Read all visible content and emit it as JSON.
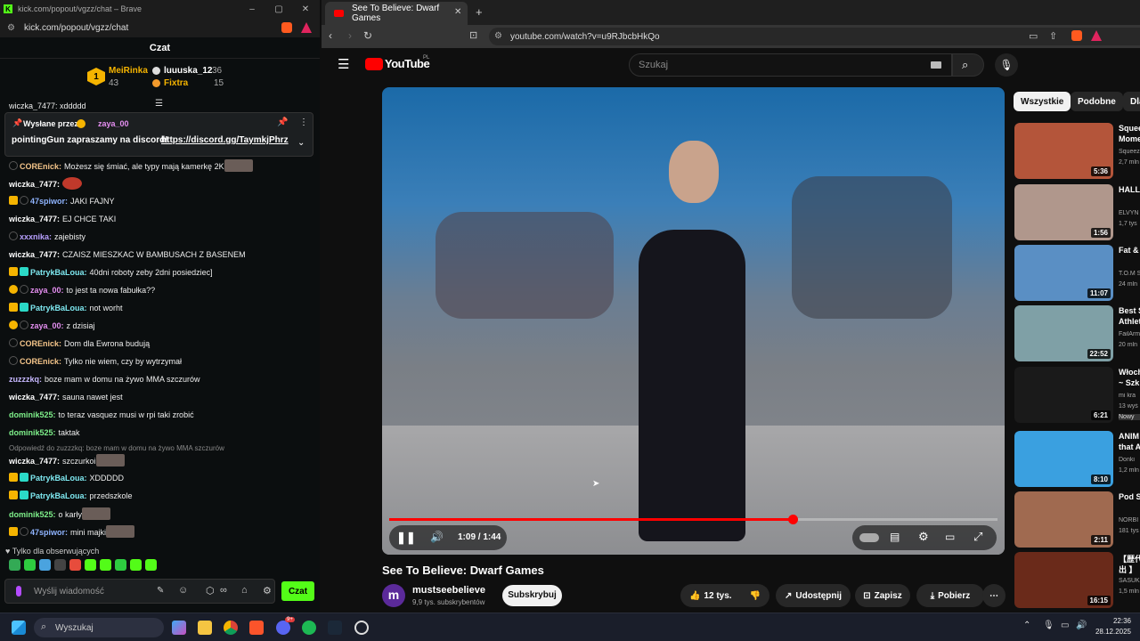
{
  "kick": {
    "window_title": "kick.com/popout/vgzz/chat – Brave",
    "url": "kick.com/popout/vgzz/chat",
    "header": "Czat",
    "leaderboard": [
      {
        "name": "MeiRinka",
        "count": "43",
        "color": "#f5b400"
      },
      {
        "name": "luuuska_12",
        "count": "36",
        "color": "#ffffff"
      },
      {
        "name": "Fixtra",
        "count": "15",
        "color": "#f5b400"
      }
    ],
    "cut_top_line": "wiczka_7477: xddddd",
    "pinned": {
      "sent_by_label": "Wysłane przez",
      "sent_by_user": "zaya_00",
      "text": "pointingGun zapraszamy na discord!",
      "link": "https://discord.gg/TaymkjPhrz"
    },
    "messages": [
      {
        "user": "COREnick:",
        "text": "Możesz się śmiać, ale typy mają kamerkę 2K",
        "color": "#f5c58a"
      },
      {
        "user": "wiczka_7477:",
        "text": "",
        "color": "#ffffff"
      },
      {
        "user": "47spiwor:",
        "text": "JAKI FAJNY",
        "color": "#8fb4ff"
      },
      {
        "user": "wiczka_7477:",
        "text": "EJ CHCE TAKI",
        "color": "#ffffff"
      },
      {
        "user": "xxxnika:",
        "text": "zajebisty",
        "color": "#b8a0ff"
      },
      {
        "user": "wiczka_7477:",
        "text": "CZAISZ MIESZKAC W BAMBUSACH Z BASENEM",
        "color": "#ffffff"
      },
      {
        "user": "PatrykBaLoua:",
        "text": "40dni roboty zeby 2dni posiedziec]",
        "color": "#7ee8f0"
      },
      {
        "user": "zaya_00:",
        "text": "to jest ta nowa fabułka??",
        "color": "#e48ef0"
      },
      {
        "user": "PatrykBaLoua:",
        "text": "not worht",
        "color": "#7ee8f0"
      },
      {
        "user": "zaya_00:",
        "text": "z dzisiaj",
        "color": "#e48ef0"
      },
      {
        "user": "COREnick:",
        "text": "Dom dla Ewrona budują",
        "color": "#f5c58a"
      },
      {
        "user": "COREnick:",
        "text": "Tylko nie wiem, czy by wytrzymał",
        "color": "#f5c58a"
      },
      {
        "user": "zuzzzkq:",
        "text": "boze mam w domu na żywo MMA szczurów",
        "color": "#c7b8ff"
      },
      {
        "user": "wiczka_7477:",
        "text": "sauna nawet jest",
        "color": "#ffffff"
      },
      {
        "user": "dominik525:",
        "text": "to teraz vasquez musi w rpi taki zrobić",
        "color": "#7ef08a"
      },
      {
        "user": "dominik525:",
        "text": "taktak",
        "color": "#7ef08a"
      },
      {
        "user": "wiczka_7477:",
        "text": "szczurkoi",
        "color": "#ffffff"
      },
      {
        "user": "PatrykBaLoua:",
        "text": "XDDDDD",
        "color": "#7ee8f0"
      },
      {
        "user": "PatrykBaLoua:",
        "text": "przedszkole",
        "color": "#7ee8f0"
      },
      {
        "user": "dominik525:",
        "text": "o karły",
        "color": "#7ef08a"
      },
      {
        "user": "47spiwor:",
        "text": "mini majki",
        "color": "#8fb4ff"
      }
    ],
    "reply_note": "Odpowiedź do zuzzzkq: boze mam w domu na żywo MMA szczurów",
    "followers_only": "Tylko dla obserwujących",
    "input_placeholder": "Wyślij wiadomość",
    "send_label": "Czat"
  },
  "youtube": {
    "tab_title": "See To Believe: Dwarf Games",
    "url": "youtube.com/watch?v=u9RJbcbHkQo",
    "logo": "YouTube",
    "logo_region": "PL",
    "search_placeholder": "Szukaj",
    "video": {
      "time": "1:09 / 1:44",
      "progress": 0.663,
      "title": "See To Believe: Dwarf Games"
    },
    "channel": {
      "avatar_letter": "m",
      "name": "mustseebelieve",
      "subs": "9,9 tys. subskrybentów"
    },
    "subscribe_label": "Subskrybuj",
    "actions": {
      "likes": "12 tys.",
      "share": "Udostępnij",
      "save": "Zapisz",
      "download": "Pobierz"
    },
    "chips": [
      "Wszystkie",
      "Podobne",
      "Dla"
    ],
    "recommendations": [
      {
        "title": "Squee",
        "line2": "Mome",
        "channel": "Squeez",
        "meta": "2,7 mln",
        "duration": "5:36",
        "thumb": "#b4553a"
      },
      {
        "title": "HALLO",
        "line2": "",
        "channel": "ELVYN",
        "meta": "1,7 tys",
        "duration": "1:56",
        "thumb": "#b0978c"
      },
      {
        "title": "Fat &",
        "line2": "",
        "channel": "T.O.M S",
        "meta": "24 mln",
        "duration": "11:07",
        "thumb": "#5a8fc4"
      },
      {
        "title": "Best S",
        "line2": "Athlet",
        "channel": "FailArm",
        "meta": "20 mln",
        "duration": "22:52",
        "thumb": "#7fa0a6"
      },
      {
        "title": "Włoch",
        "line2": "~ Szk",
        "channel": "mi kra",
        "meta": "13 wyś",
        "duration": "6:21",
        "thumb": "#1a1a1a",
        "badge": "Nowy"
      },
      {
        "title": "ANIM",
        "line2": "that A",
        "channel": "Donki",
        "meta": "1,2 mln",
        "duration": "8:10",
        "thumb": "#3aa0e0"
      },
      {
        "title": "Pod S",
        "line2": "",
        "channel": "NORBI",
        "meta": "181 tys",
        "duration": "2:11",
        "thumb": "#a06a50"
      },
      {
        "title": "【歴代",
        "line2": "出 】",
        "channel": "SASUK",
        "meta": "1,5 mln",
        "duration": "16:15",
        "thumb": "#6a2a1a"
      }
    ]
  },
  "taskbar": {
    "search_placeholder": "Wyszukaj",
    "time": "22:36",
    "date": "28.12.2025",
    "discord_badge": "9+"
  }
}
